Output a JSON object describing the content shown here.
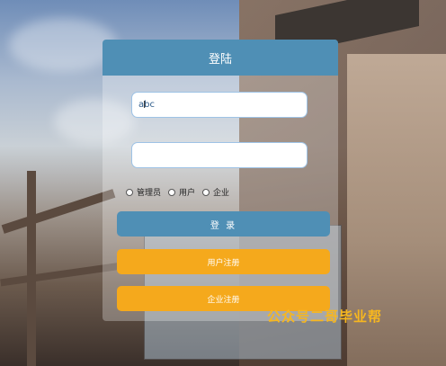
{
  "panel": {
    "title": "登陆"
  },
  "form": {
    "username_value": "abc",
    "password_value": "",
    "roles": [
      {
        "label": "管理员"
      },
      {
        "label": "用户"
      },
      {
        "label": "企业"
      }
    ]
  },
  "buttons": {
    "login": "登 录",
    "user_register": "用户注册",
    "company_register": "企业注册"
  },
  "watermark": "公众号二哥毕业帮",
  "colors": {
    "header": "#4f8fb5",
    "primary_button": "#4f8fb5",
    "register_button": "#f5a91c",
    "watermark": "#f7b71f"
  }
}
